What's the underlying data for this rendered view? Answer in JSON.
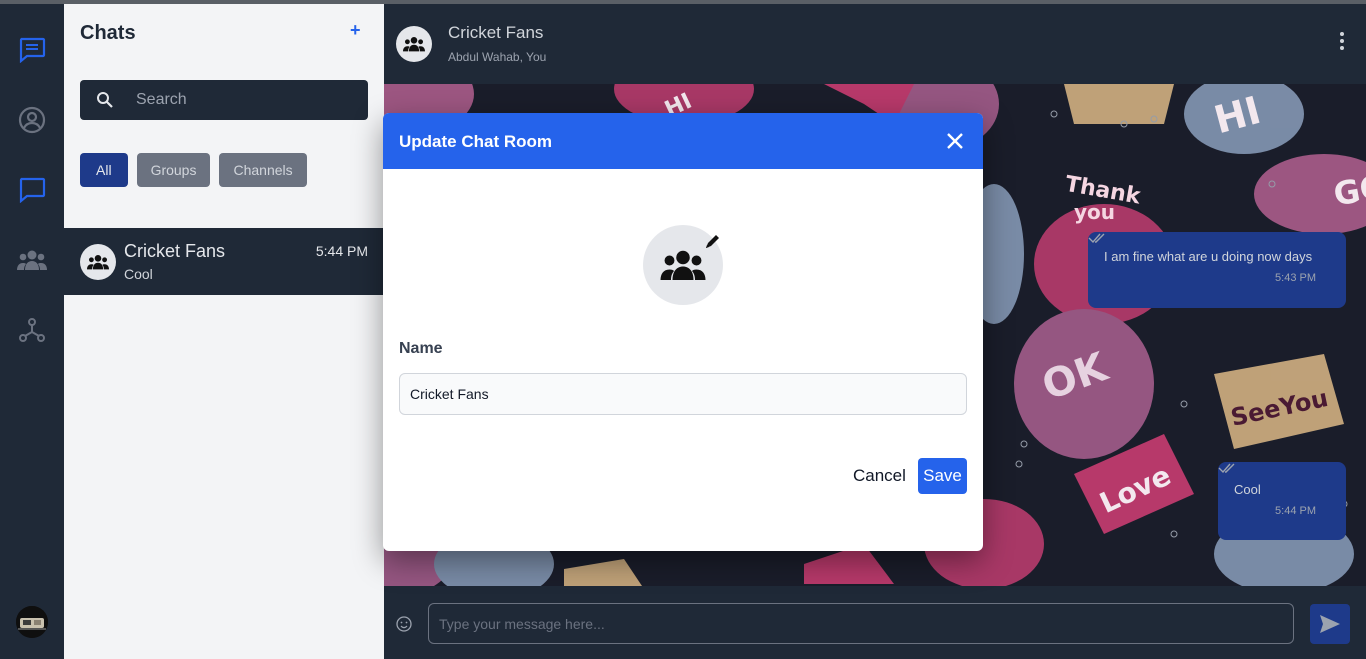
{
  "sidebar": {
    "icons": [
      "chat-bubble-icon",
      "user-circle-icon",
      "message-square-icon",
      "users-icon",
      "network-icon"
    ],
    "accent": "#2563eb"
  },
  "chat_list": {
    "title": "Chats",
    "add_label": "+",
    "search_placeholder": "Search",
    "filters": [
      {
        "label": "All",
        "active": true
      },
      {
        "label": "Groups",
        "active": false
      },
      {
        "label": "Channels",
        "active": false
      }
    ],
    "items": [
      {
        "name": "Cricket Fans",
        "last_message": "Cool",
        "time": "5:44 PM",
        "selected": true
      }
    ]
  },
  "conversation": {
    "title": "Cricket Fans",
    "members": "Abdul Wahab, You",
    "messages": [
      {
        "text": "I am fine what are u doing now days",
        "time": "5:43 PM",
        "status": "read"
      },
      {
        "text": "Cool",
        "time": "5:44 PM",
        "status": "read"
      }
    ],
    "composer_placeholder": "Type your message here..."
  },
  "modal": {
    "title": "Update Chat Room",
    "name_label": "Name",
    "name_value": "Cricket Fans",
    "cancel_label": "Cancel",
    "save_label": "Save",
    "header_color": "#2563eb"
  }
}
